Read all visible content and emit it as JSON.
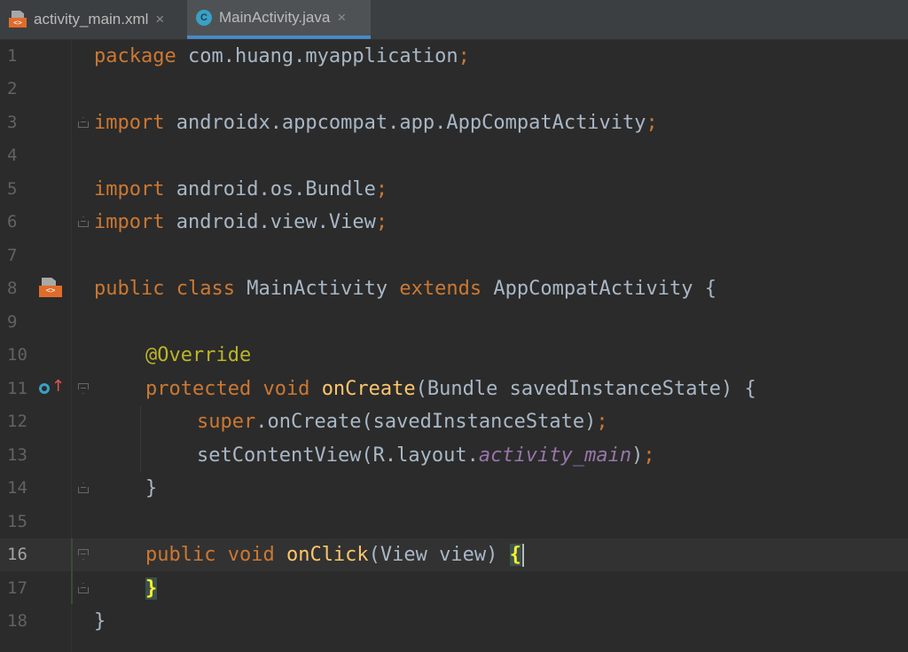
{
  "tabs": [
    {
      "label": "activity_main.xml",
      "icon": "layout-xml-icon",
      "close": "×",
      "active": false
    },
    {
      "label": "MainActivity.java",
      "icon": "java-class-icon",
      "icon_letter": "C",
      "close": "×",
      "active": true
    }
  ],
  "editor": {
    "line_numbers": [
      "1",
      "2",
      "3",
      "4",
      "5",
      "6",
      "7",
      "8",
      "9",
      "10",
      "11",
      "12",
      "13",
      "14",
      "15",
      "16",
      "17",
      "18"
    ],
    "current_line": "16",
    "gutter_icons": {
      "line_8": {
        "name": "layout-file-icon",
        "text": "<>"
      },
      "line_11": {
        "name": "override-method-icon",
        "arrow": "↑"
      }
    },
    "code": {
      "l1": {
        "kw": "package",
        "rest": " com.huang.myapplication",
        "semi": ";"
      },
      "l3": {
        "kw": "import",
        "rest": " androidx.appcompat.app.AppCompatActivity",
        "semi": ";"
      },
      "l5": {
        "kw": "import",
        "rest": " android.os.Bundle",
        "semi": ";"
      },
      "l6": {
        "kw": "import",
        "rest": " android.view.View",
        "semi": ";"
      },
      "l8": {
        "kw1": "public class",
        "name": " MainActivity ",
        "kw2": "extends",
        "rest": " AppCompatActivity {"
      },
      "l10": {
        "annotation": "@Override"
      },
      "l11": {
        "kw": "protected void",
        "sp": " ",
        "fn": "onCreate",
        "rest": "(Bundle savedInstanceState) {"
      },
      "l12": {
        "kw": "super",
        "rest": ".onCreate(savedInstanceState)",
        "semi": ";"
      },
      "l13": {
        "pre": "setContentView(R.layout.",
        "field": "activity_main",
        "post": ")",
        "semi": ";"
      },
      "l14": {
        "text": "}"
      },
      "l16": {
        "kw": "public void",
        "sp": " ",
        "fn": "onClick",
        "rest": "(View view) ",
        "brace": "{"
      },
      "l17": {
        "brace": "}"
      },
      "l18": {
        "text": "}"
      }
    }
  },
  "colors": {
    "background": "#2b2b2b",
    "keyword": "#cc7832",
    "method": "#ffc66d",
    "annotation": "#bbb529",
    "field": "#9876aa",
    "text": "#a9b7c6",
    "tab_active_underline": "#4a88c7"
  }
}
